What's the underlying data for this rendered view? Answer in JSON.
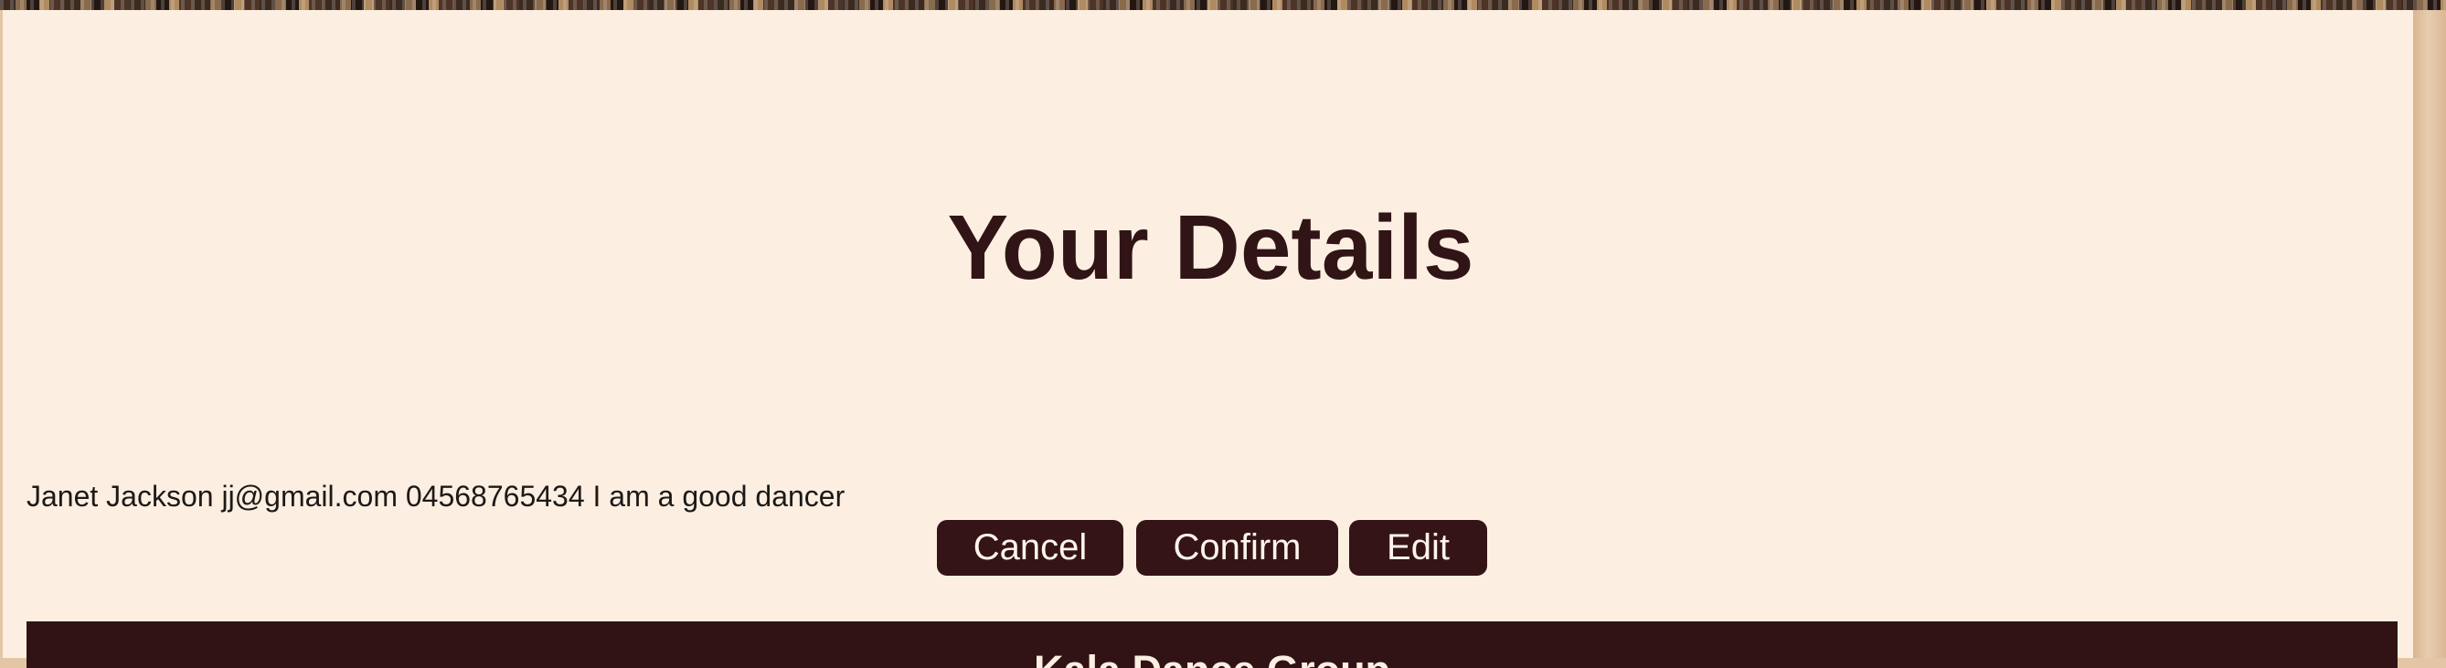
{
  "page": {
    "title": "Your Details"
  },
  "user_details": {
    "text": "Janet Jackson jj@gmail.com 04568765434 I am a good dancer",
    "name": "Janet Jackson",
    "email": "jj@gmail.com",
    "phone": "04568765434",
    "bio": "I am a good dancer"
  },
  "actions": {
    "cancel_label": "Cancel",
    "confirm_label": "Confirm",
    "edit_label": "Edit"
  },
  "footer": {
    "title": "Kala Dance Group"
  },
  "colors": {
    "panel_background": "#fcefe1",
    "title_text": "#311516",
    "button_background": "#351417",
    "button_text": "#fff5ec",
    "footer_background": "#311315",
    "footer_text": "#fbefe3"
  }
}
